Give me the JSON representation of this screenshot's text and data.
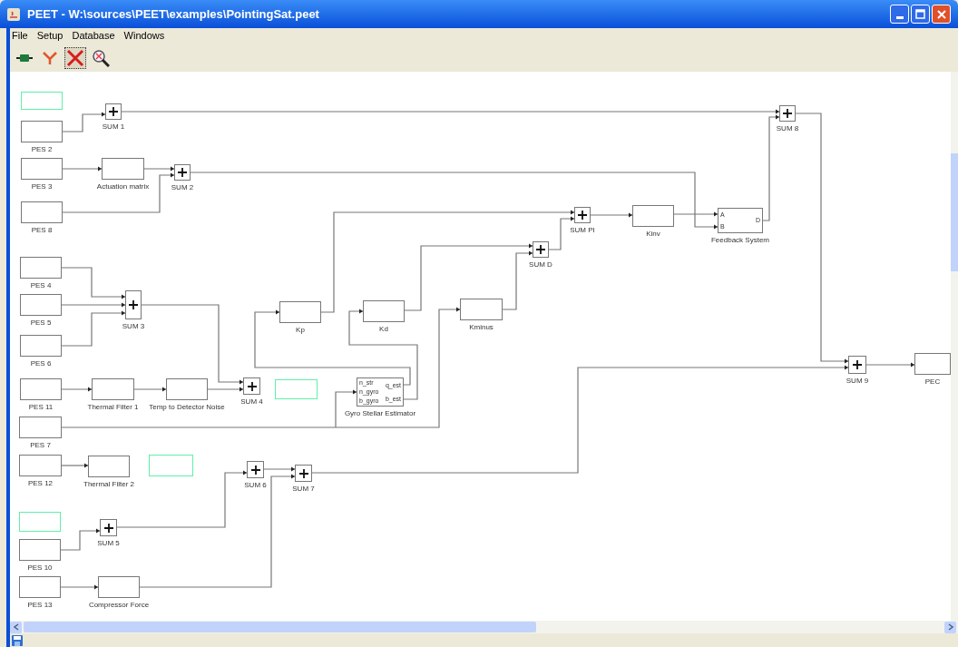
{
  "window": {
    "title": "PEET - W:\\sources\\PEET\\examples\\PointingSat.peet"
  },
  "menu": [
    "File",
    "Setup",
    "Database",
    "Windows"
  ],
  "toolbar": [
    {
      "kind": "connect",
      "selected": false
    },
    {
      "kind": "branch",
      "selected": false
    },
    {
      "kind": "delete",
      "selected": true
    },
    {
      "kind": "zoom",
      "selected": false
    }
  ],
  "blocks": [
    {
      "kind": "empty"
    },
    {
      "kind": "block",
      "label": "PES 2"
    },
    {
      "kind": "sum",
      "label": "SUM 1"
    },
    {
      "kind": "block",
      "label": "PES 3"
    },
    {
      "kind": "block",
      "label": "Actuation matrix"
    },
    {
      "kind": "sum",
      "label": "SUM 2"
    },
    {
      "kind": "block",
      "label": "PES 8"
    },
    {
      "kind": "block",
      "label": "PES 4"
    },
    {
      "kind": "block",
      "label": "PES 5"
    },
    {
      "kind": "sum",
      "label": "SUM 3"
    },
    {
      "kind": "block",
      "label": "PES 6"
    },
    {
      "kind": "block",
      "label": "Kp"
    },
    {
      "kind": "block",
      "label": "Kd"
    },
    {
      "kind": "block",
      "label": "Kminus"
    },
    {
      "kind": "sum",
      "label": "SUM D"
    },
    {
      "kind": "sum",
      "label": "SUM PI"
    },
    {
      "kind": "block",
      "label": "Kinv"
    },
    {
      "kind": "subsystem",
      "label": "Feedback System",
      "inputs": [
        "A",
        "B"
      ],
      "outputs": [
        "D"
      ]
    },
    {
      "kind": "sum",
      "label": "SUM 8"
    },
    {
      "kind": "block",
      "label": "PES 11"
    },
    {
      "kind": "block",
      "label": "Thermal Filter 1"
    },
    {
      "kind": "block",
      "label": "Temp to Detector Noise"
    },
    {
      "kind": "sum",
      "label": "SUM 4"
    },
    {
      "kind": "empty"
    },
    {
      "kind": "subsystem",
      "label": "Gyro Stellar Estimator",
      "inputs": [
        "n_str",
        "n_gyro",
        "b_gyro"
      ],
      "outputs": [
        "q_est",
        "b_est"
      ]
    },
    {
      "kind": "block",
      "label": "PES 7"
    },
    {
      "kind": "sum",
      "label": "SUM 9"
    },
    {
      "kind": "block",
      "label": "PEC"
    },
    {
      "kind": "block",
      "label": "PES 12"
    },
    {
      "kind": "block",
      "label": "Thermal Filter 2"
    },
    {
      "kind": "empty"
    },
    {
      "kind": "sum",
      "label": "SUM 6"
    },
    {
      "kind": "sum",
      "label": "SUM 7"
    },
    {
      "kind": "empty"
    },
    {
      "kind": "sum",
      "label": "SUM 5"
    },
    {
      "kind": "block",
      "label": "PES 10"
    },
    {
      "kind": "block",
      "label": "PES 13"
    },
    {
      "kind": "block",
      "label": "Compressor Force"
    }
  ]
}
